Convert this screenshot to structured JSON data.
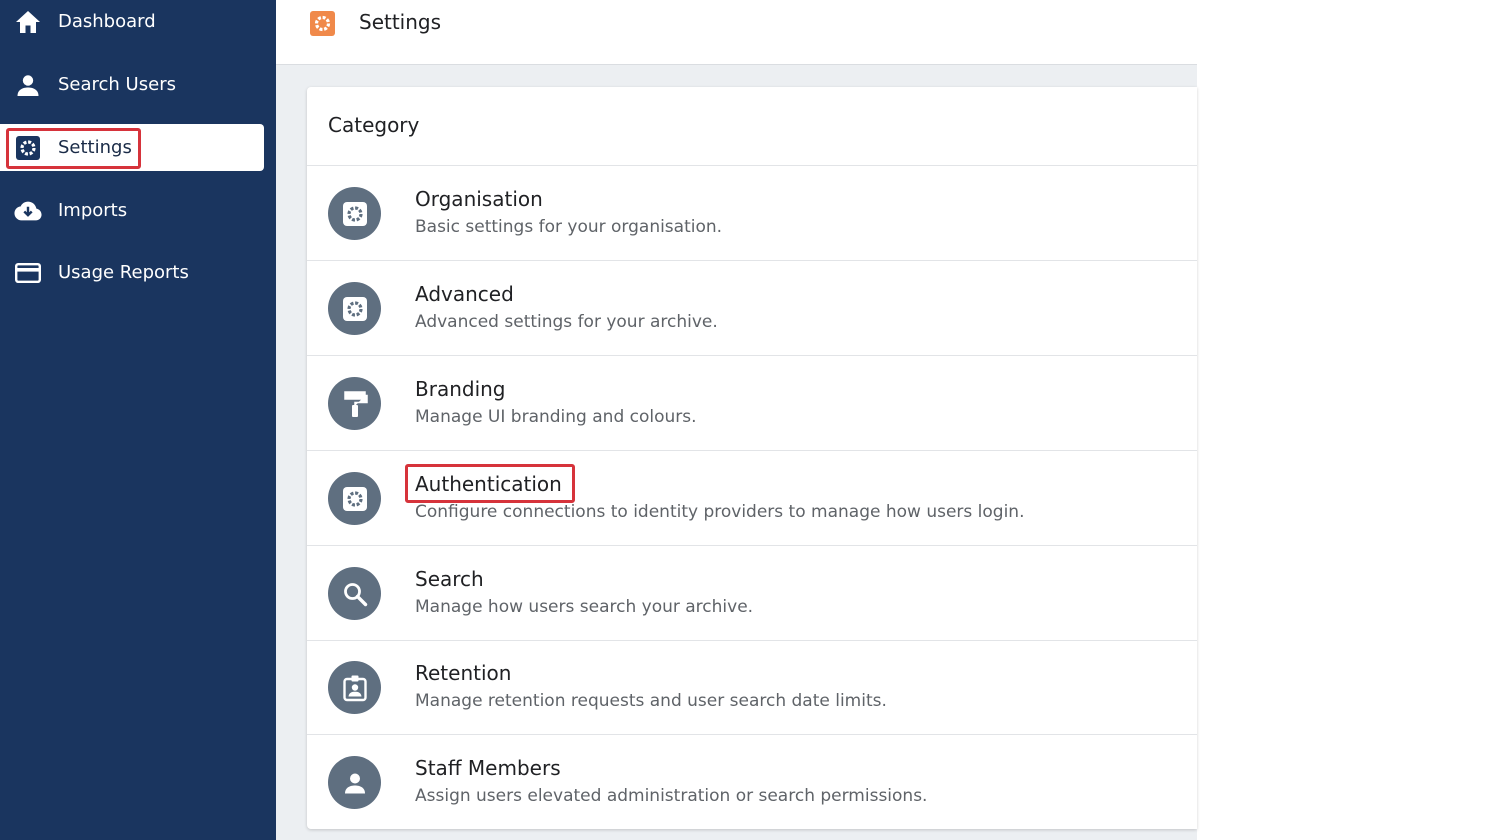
{
  "sidebar": {
    "items": [
      {
        "label": "Dashboard",
        "icon": "home-icon"
      },
      {
        "label": "Search Users",
        "icon": "person-icon"
      },
      {
        "label": "Settings",
        "icon": "gear-icon",
        "active": true
      },
      {
        "label": "Imports",
        "icon": "cloud-download-icon"
      },
      {
        "label": "Usage Reports",
        "icon": "credit-card-icon"
      }
    ]
  },
  "header": {
    "title": "Settings",
    "icon": "gear-icon",
    "icon_color": "#f0894a"
  },
  "category": {
    "title": "Category",
    "items": [
      {
        "title": "Organisation",
        "description": "Basic settings for your organisation.",
        "icon": "gear-icon"
      },
      {
        "title": "Advanced",
        "description": "Advanced settings for your archive.",
        "icon": "gear-icon"
      },
      {
        "title": "Branding",
        "description": "Manage UI branding and colours.",
        "icon": "paint-roller-icon"
      },
      {
        "title": "Authentication",
        "description": "Configure connections to identity providers to manage how users login.",
        "icon": "gear-icon",
        "highlighted": true
      },
      {
        "title": "Search",
        "description": "Manage how users search your archive.",
        "icon": "search-icon"
      },
      {
        "title": "Retention",
        "description": "Manage retention requests and user search date limits.",
        "icon": "badge-icon"
      },
      {
        "title": "Staff Members",
        "description": "Assign users elevated administration or search permissions.",
        "icon": "person-icon"
      }
    ]
  },
  "colors": {
    "sidebar_bg": "#1a355f",
    "highlight": "#d6333b",
    "avatar_bg": "#5f6f80"
  }
}
